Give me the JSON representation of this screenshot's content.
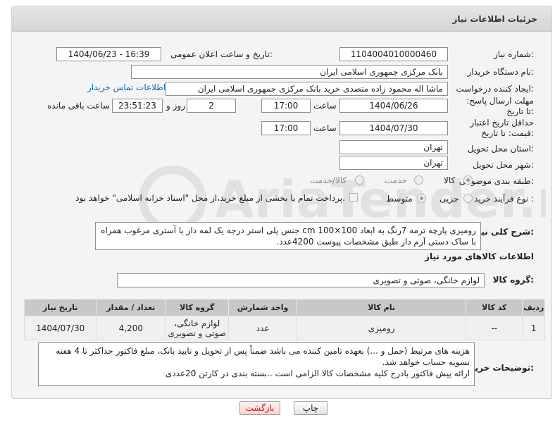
{
  "header": {
    "title": "جزئیات اطلاعات نیاز"
  },
  "labels": {
    "need_number": "شماره نیاز:",
    "announce_datetime": "تاریخ و ساعت اعلان عمومی:",
    "buyer_org": "نام دستگاه خریدار:",
    "requester": "ایجاد کننده درخواست:",
    "reply_deadline": "مهلت ارسال پاسخ: تا تاریخ:",
    "price_validity": "حداقل تاریخ اعتبار قیمت: تا تاریخ:",
    "delivery_province": "استان محل تحویل:",
    "delivery_city": "شهر محل تحویل:",
    "subject_class": "طبقه بندی موضوعی:",
    "process_type": "نوع فرآیند خرید :",
    "time": "ساعت",
    "time2": "ساعت",
    "day_and": "روز و",
    "remaining": "ساعت باقی مانده",
    "general_desc": "شرح کلی نیاز:",
    "goods_info": "اطلاعات کالاهای مورد نیاز",
    "goods_group": "گروه کالا:",
    "buyer_notes": "توضیحات خریدار:"
  },
  "values": {
    "need_number": "1104004010000460",
    "announce_datetime": "1404/06/23 - 16:39",
    "buyer_org": "بانک مرکزی جمهوری اسلامی ایران",
    "requester": "ماشا اله محمود زاده متصدی خرید بانک مرکزی جمهوری اسلامی ایران",
    "buyer_contact_link": "اطلاعات تماس خریدار",
    "reply_date": "1404/06/26",
    "reply_time": "17:00",
    "reply_days": "2",
    "reply_remaining": "23:51:23",
    "price_date": "1404/07/30",
    "price_time": "17:00",
    "province": "تهران",
    "city": "تهران",
    "goods_group": "لوازم خانگی، صوتی و تصویری"
  },
  "subject_options": [
    {
      "label": "کالا",
      "selected": true
    },
    {
      "label": "خدمت",
      "selected": false
    },
    {
      "label": "کالا/خدمت",
      "selected": false
    }
  ],
  "process_options": [
    {
      "label": "جزیی",
      "selected": false
    },
    {
      "label": "متوسط",
      "selected": true
    }
  ],
  "payment_note": "پرداخت تمام یا بخشی از مبلغ خرید،از محل \"اسناد خزانه اسلامی\" خواهد بود.",
  "general_description": "رومیزی پارچه ترمه 7رنگ  به ابعاد 100×100 cm جنس پلی استر درجه یک لمه دار با آستری مرغوب همراه با ساک دستی آرم دار طبق مشخصات پیوست 4200عدد.",
  "table": {
    "headers": [
      "ردیف",
      "کد کالا",
      "نام کالا",
      "واحد شمارش",
      "گروه کالا",
      "تعداد / مقدار",
      "تاریخ نیاز"
    ],
    "rows": [
      [
        "1",
        "--",
        "رومیزی",
        "عدد",
        "لوازم خانگی، صوتی و تصویری",
        "4,200",
        "1404/07/30"
      ]
    ]
  },
  "buyer_notes": "هزینه های مرتبط (حمل و ...) بعهده تامین کننده می باشد ضمناً پس از تحویل و تایید بانک، مبلغ فاکتور حداکثر تا 4 هفته تسویه حساب خواهد شد.\nارائه پیش فاکتور بادرج کلیه مشخصات کالا الزامی است ..بسته بندی در کارتن 20عددی",
  "buttons": {
    "print": "چاپ",
    "back": "بازگشت"
  },
  "watermark": "AriaTender.neT"
}
